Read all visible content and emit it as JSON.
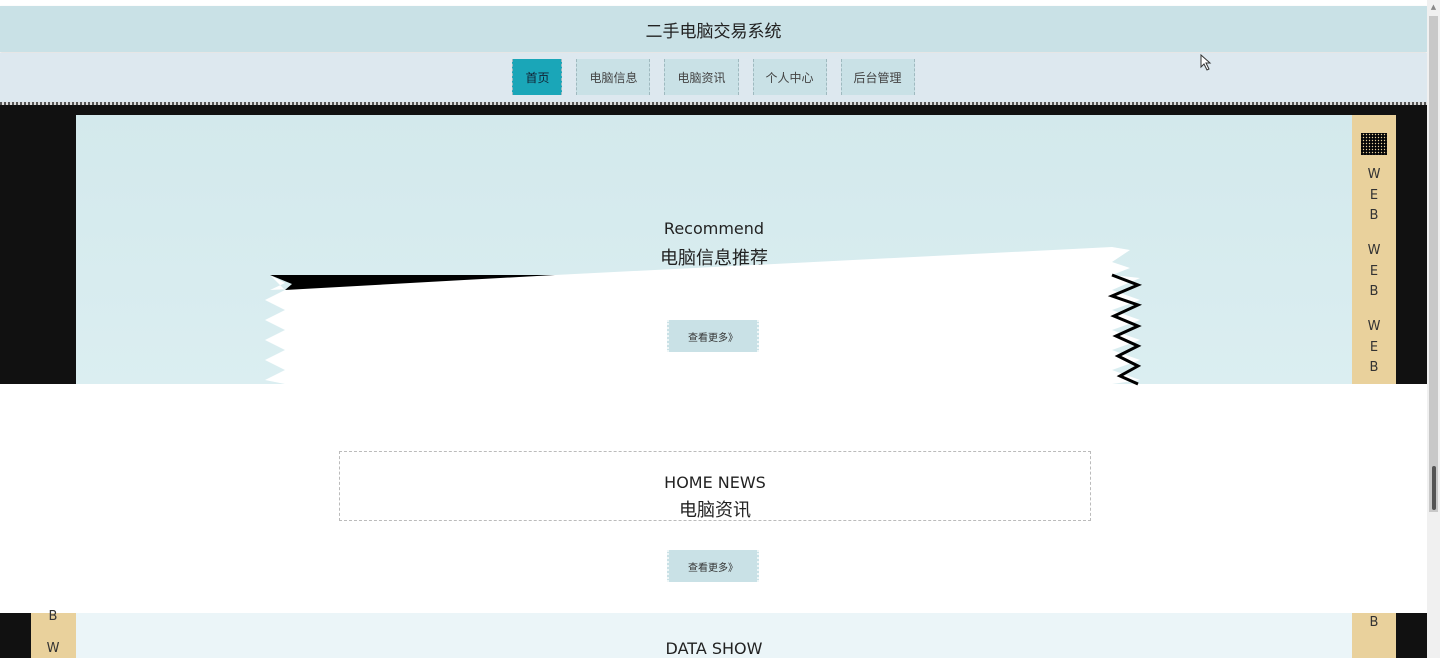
{
  "header": {
    "title": "二手电脑交易系统"
  },
  "nav": {
    "items": [
      {
        "label": "首页",
        "active": true
      },
      {
        "label": "电脑信息",
        "active": false
      },
      {
        "label": "电脑资讯",
        "active": false
      },
      {
        "label": "个人中心",
        "active": false
      },
      {
        "label": "后台管理",
        "active": false
      }
    ]
  },
  "recommend": {
    "title_en": "Recommend",
    "title_cn": "电脑信息推荐",
    "more_label": "查看更多》"
  },
  "side_strip": {
    "letters": [
      "W",
      "E",
      "B",
      "W",
      "E",
      "B",
      "W",
      "E",
      "B"
    ],
    "bottom_left_letters": [
      "B",
      "W"
    ],
    "bottom_right_letters": [
      "B"
    ]
  },
  "news": {
    "title_en": "HOME NEWS",
    "title_cn": "电脑资讯",
    "more_label": "查看更多》"
  },
  "data_show": {
    "title_en": "DATA SHOW"
  },
  "colors": {
    "header_bg": "#c9e1e6",
    "nav_bg": "#dde8ef",
    "active_nav": "#1aa6b8",
    "accent_strip": "#e9d19c"
  }
}
